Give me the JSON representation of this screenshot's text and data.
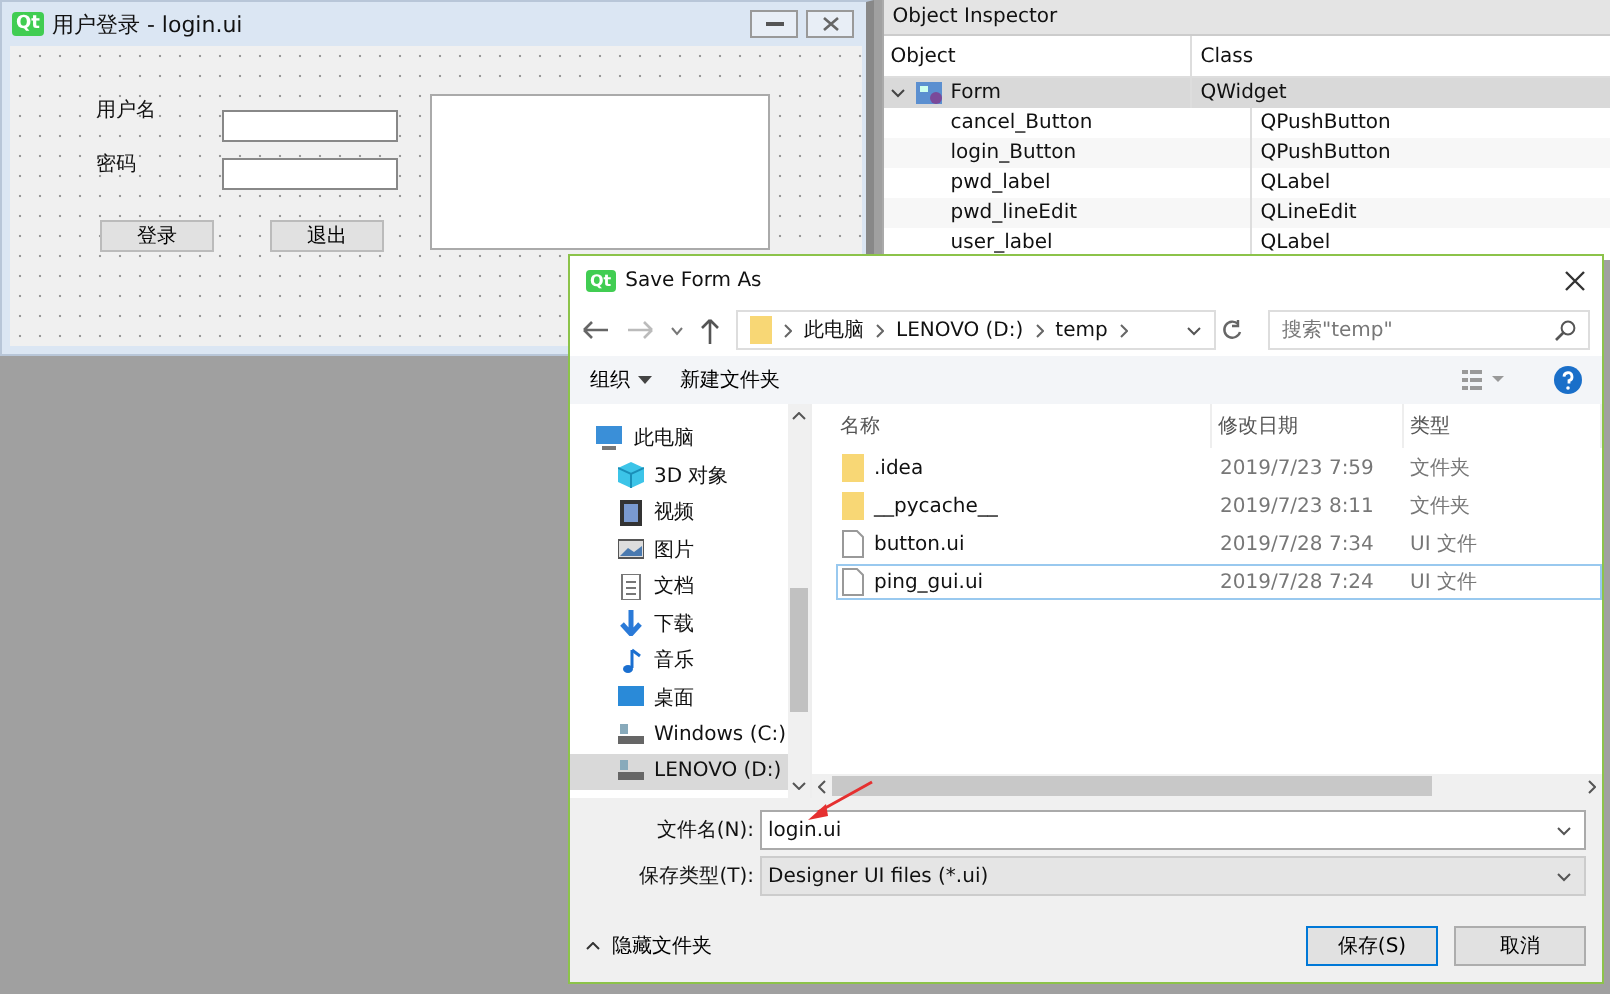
{
  "designer": {
    "logo": "Qt",
    "title": "用户登录 - login.ui",
    "labels": [
      "用户名",
      "密码"
    ],
    "buttons": [
      "登录",
      "退出"
    ]
  },
  "object_inspector": {
    "title": "Object Inspector",
    "columns": [
      "Object",
      "Class"
    ],
    "tree": [
      {
        "object": "Form",
        "class": "QWidget",
        "selected": true,
        "expanded": true,
        "children": [
          {
            "object": "cancel_Button",
            "class": "QPushButton",
            "selected": false
          },
          {
            "object": "login_Button",
            "class": "QPushButton",
            "selected": false
          },
          {
            "object": "pwd_label",
            "class": "QLabel",
            "selected": false
          },
          {
            "object": "pwd_lineEdit",
            "class": "QLineEdit",
            "selected": false
          },
          {
            "object": "user_label",
            "class": "QLabel",
            "selected": false
          }
        ]
      }
    ]
  },
  "dialog": {
    "logo": "Qt",
    "title": "Save Form As",
    "path": [
      "此电脑",
      "LENOVO (D:)",
      "temp"
    ],
    "search": {
      "placeholder": "搜索\"temp\""
    },
    "toolbar": [
      "组织",
      "新建文件夹"
    ],
    "nav": [
      {
        "label": "此电脑",
        "kind": "pc",
        "selected": false,
        "children": [
          {
            "label": "3D 对象",
            "kind": "cube",
            "selected": false
          },
          {
            "label": "视频",
            "kind": "video",
            "selected": false
          },
          {
            "label": "图片",
            "kind": "picture",
            "selected": false
          },
          {
            "label": "文档",
            "kind": "document",
            "selected": false
          },
          {
            "label": "下载",
            "kind": "download",
            "selected": false
          },
          {
            "label": "音乐",
            "kind": "music",
            "selected": false
          },
          {
            "label": "桌面",
            "kind": "desktop",
            "selected": false
          },
          {
            "label": "Windows (C:)",
            "kind": "drive",
            "selected": false
          },
          {
            "label": "LENOVO (D:)",
            "kind": "drive",
            "selected": true
          }
        ]
      }
    ],
    "columns": [
      "名称",
      "修改日期",
      "类型"
    ],
    "files": [
      {
        "name": ".idea",
        "date": "2019/7/23 7:59",
        "type": "文件夹",
        "kind": "folder",
        "selected": false
      },
      {
        "name": "__pycache__",
        "date": "2019/7/23 8:11",
        "type": "文件夹",
        "kind": "folder",
        "selected": false
      },
      {
        "name": "button.ui",
        "date": "2019/7/28 7:34",
        "type": "UI 文件",
        "kind": "file",
        "selected": false
      },
      {
        "name": "ping_gui.ui",
        "date": "2019/7/28 7:24",
        "type": "UI 文件",
        "kind": "file",
        "selected": true
      }
    ],
    "filename_label": "文件名(N):",
    "filename": "login.ui",
    "filetype_label": "保存类型(T):",
    "filetype": "Designer UI files (*.ui)",
    "hide_folders": "隐藏文件夹",
    "buttons": [
      "保存(S)",
      "取消"
    ]
  }
}
